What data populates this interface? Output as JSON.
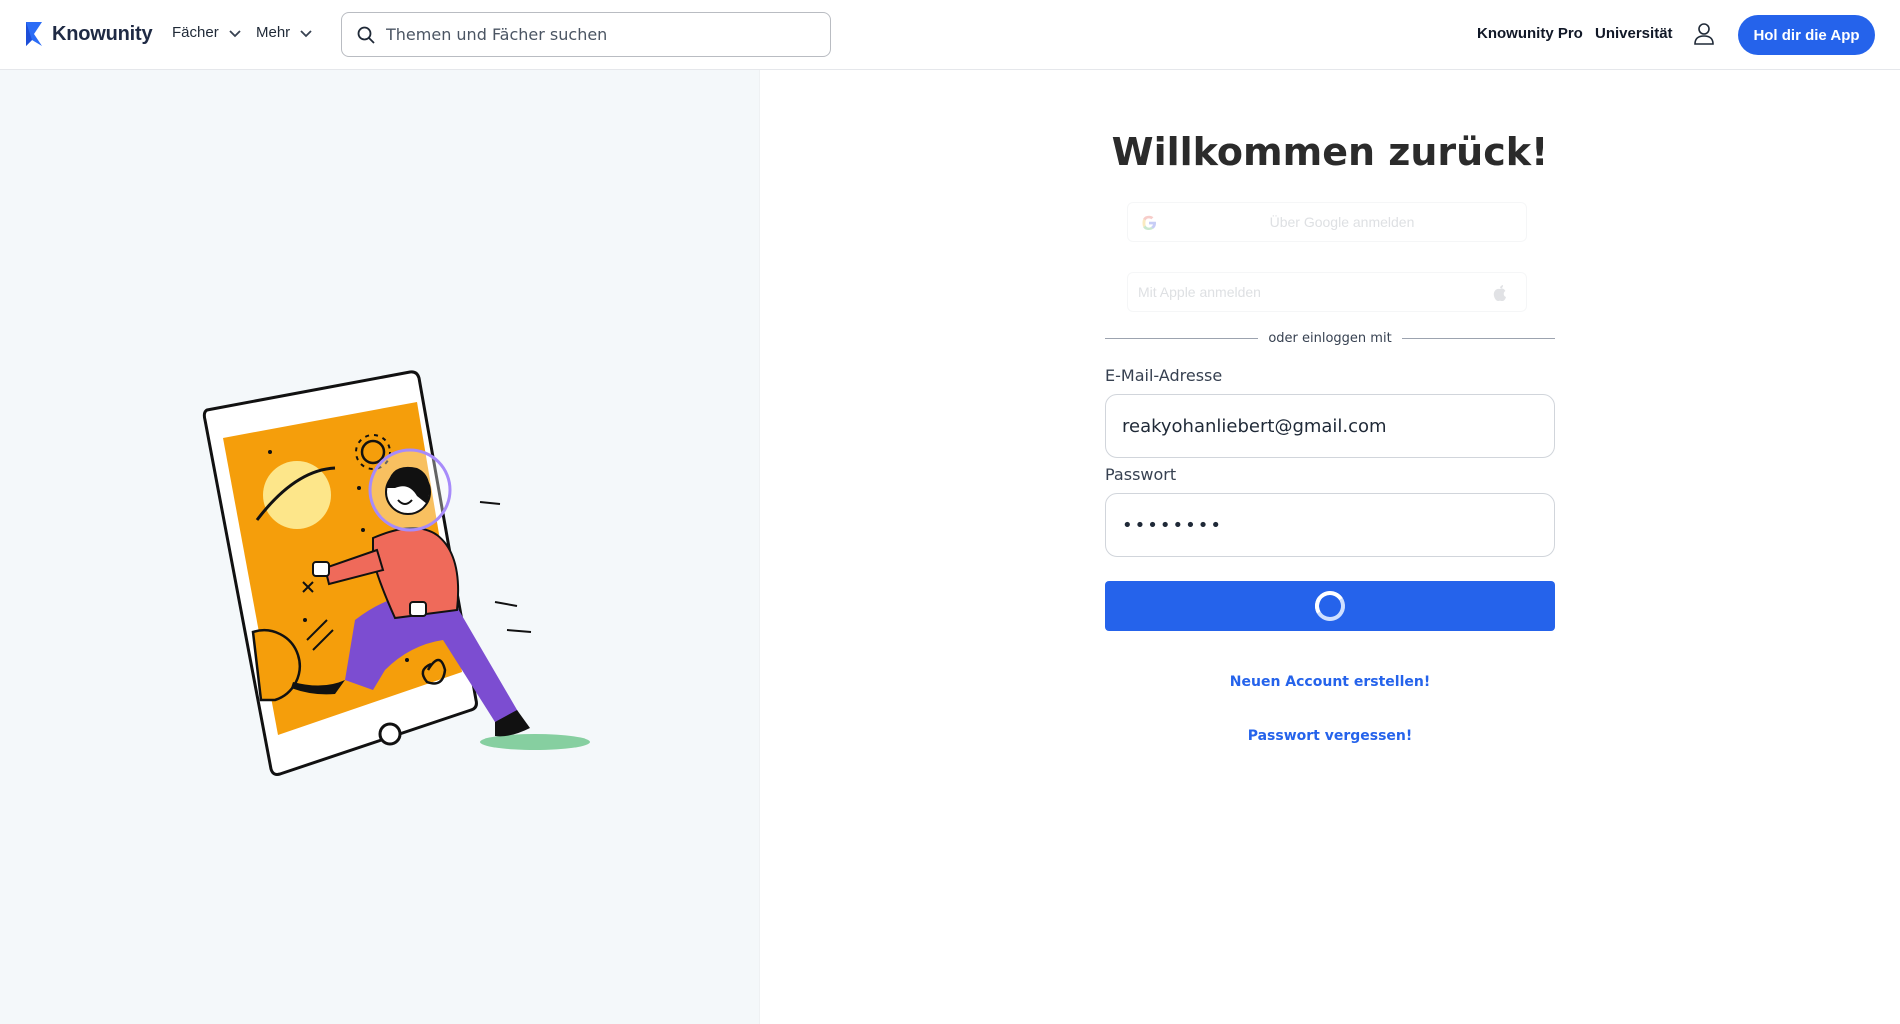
{
  "header": {
    "brand": "Knowunity",
    "nav": [
      {
        "label": "Fächer"
      },
      {
        "label": "Mehr"
      }
    ],
    "search": {
      "placeholder": "Themen und Fächer suchen",
      "value": ""
    },
    "links": {
      "pro": "Knowunity Pro",
      "university": "Universität"
    },
    "cta": "Hol dir die App",
    "colors": {
      "accent": "#2563eb"
    }
  },
  "login": {
    "title": "Willkommen zurück!",
    "google_label": "Über Google anmelden",
    "apple_label": "Mit Apple anmelden",
    "divider": "oder einloggen mit",
    "email_label": "E-Mail-Adresse",
    "email_value": "reakyohanliebert@gmail.com",
    "password_label": "Passwort",
    "password_value": "password",
    "submit_state": "loading",
    "create_account": "Neuen Account erstellen!",
    "forgot_password": "Passwort vergessen!"
  }
}
